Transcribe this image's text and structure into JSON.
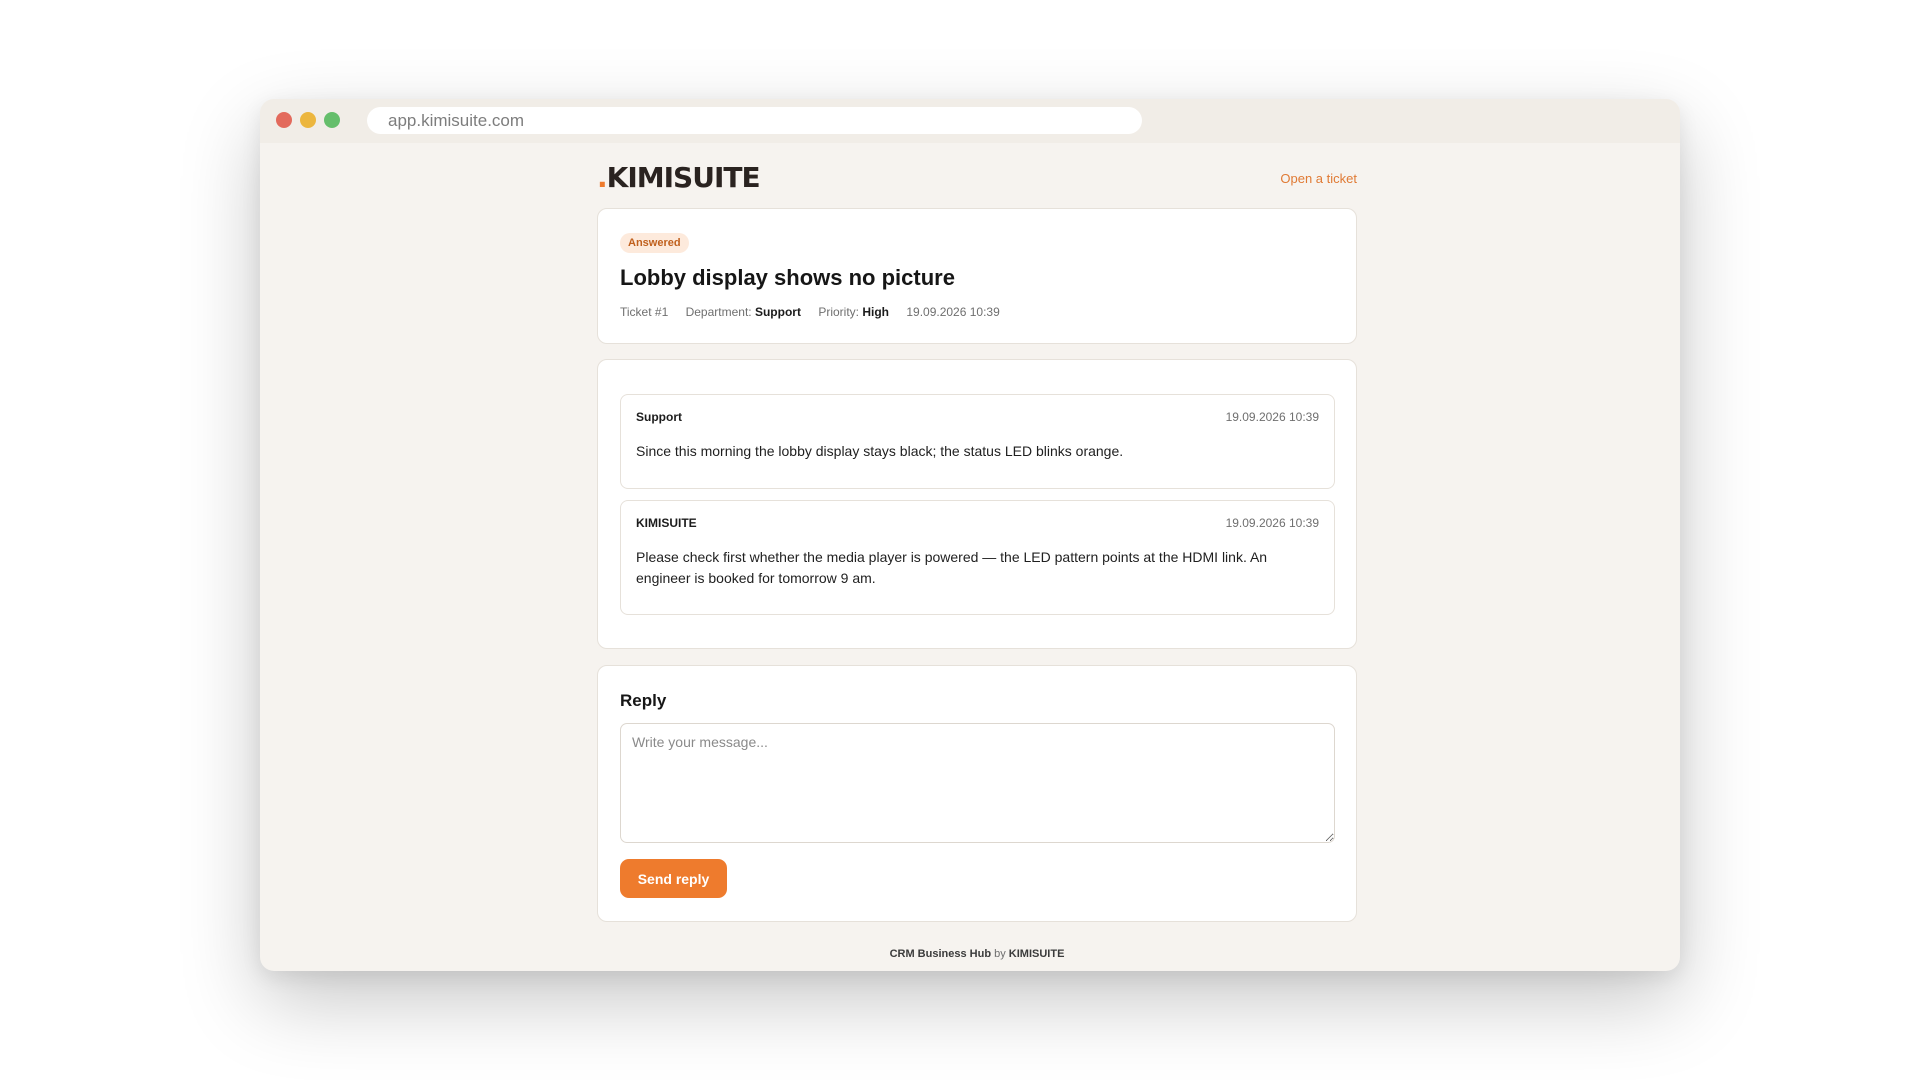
{
  "browser": {
    "url": "app.kimisuite.com"
  },
  "header": {
    "logo_dot": ".",
    "logo_text": "KIMISUITE",
    "open_ticket_label": "Open a ticket"
  },
  "ticket": {
    "status": "Answered",
    "title": "Lobby display shows no picture",
    "number": "Ticket #1",
    "department_label": "Department:",
    "department": "Support",
    "priority_label": "Priority:",
    "priority": "High",
    "created": "19.09.2026 10:39"
  },
  "messages": [
    {
      "author": "Support",
      "time": "19.09.2026 10:39",
      "body": "Since this morning the lobby display stays black; the status LED blinks orange."
    },
    {
      "author": "KIMISUITE",
      "time": "19.09.2026 10:39",
      "body": "Please check first whether the media player is powered — the LED pattern points at the HDMI link. An engineer is booked for tomorrow 9 am."
    }
  ],
  "reply": {
    "title": "Reply",
    "placeholder": "Write your message...",
    "value": "",
    "send_label": "Send reply"
  },
  "footer": {
    "product": "CRM Business Hub",
    "by": "by",
    "brand": "KIMISUITE"
  },
  "colors": {
    "accent": "#ee7b2d",
    "background": "#f6f3ef",
    "badge_bg": "#fdeadc"
  }
}
